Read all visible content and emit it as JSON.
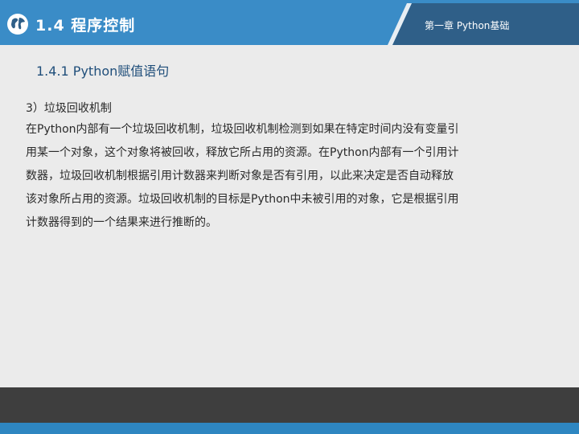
{
  "header": {
    "section_title": "1.4 程序控制",
    "chapter_label": "第一章 Python基础",
    "logo_icon": "globe-icon"
  },
  "colors": {
    "header_blue": "#3a8cc7",
    "header_dark": "#2f5f88",
    "accent_blue": "#2e86c1",
    "footer_dark": "#3e3e3e",
    "background": "#ebebeb"
  },
  "content": {
    "subheading": "1.4.1 Python赋值语句",
    "point_title": "3）垃圾回收机制",
    "paragraph_lines": [
      "在Python内部有一个垃圾回收机制，垃圾回收机制检测到如果在特定时间内没有变量引",
      "用某一个对象，这个对象将被回收，释放它所占用的资源。在Python内部有一个引用计",
      "数器，垃圾回收机制根据引用计数器来判断对象是否有引用，以此来决定是否自动释放",
      "该对象所占用的资源。垃圾回收机制的目标是Python中未被引用的对象，它是根据引用",
      "计数器得到的一个结果来进行推断的。"
    ]
  }
}
